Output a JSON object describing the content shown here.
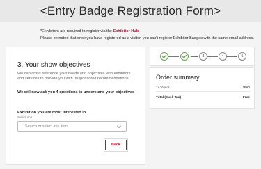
{
  "banner": {
    "title": "<Entry Badge Registration Form>"
  },
  "notice": {
    "line1_prefix": "*Exhibitors are required to register via the ",
    "line1_link": "Exhibitor Hub",
    "line1_suffix": ".",
    "line2": "Please be noted that once you have registered as a visitor, you can't register Exhibitor Badges with the same email address."
  },
  "step": {
    "title": "3. Your show objectives",
    "description": "We can cross reference your needs and objectives with exhibitors and services to provide you with unsponsored recommendations.",
    "questions_note": "We will now ask you 4 questions to understand your objectives"
  },
  "field": {
    "label": "Exhibition you are most interested in",
    "sublabel": "Select one",
    "placeholder": "Search or select any item..."
  },
  "buttons": {
    "back": "Back"
  },
  "progress": {
    "steps": [
      {
        "label": "",
        "state": "done"
      },
      {
        "label": "",
        "state": "done"
      },
      {
        "label": "3",
        "state": "current"
      },
      {
        "label": "4",
        "state": "todo"
      },
      {
        "label": "5",
        "state": "todo"
      }
    ]
  },
  "order": {
    "title": "Order summary",
    "item_label": "1x Visitor",
    "item_price": "JP¥0",
    "total_label": "Total (Excl. Tax)",
    "total_value": "Free"
  },
  "colors": {
    "accent": "#c8102e",
    "done": "#5fa846"
  }
}
